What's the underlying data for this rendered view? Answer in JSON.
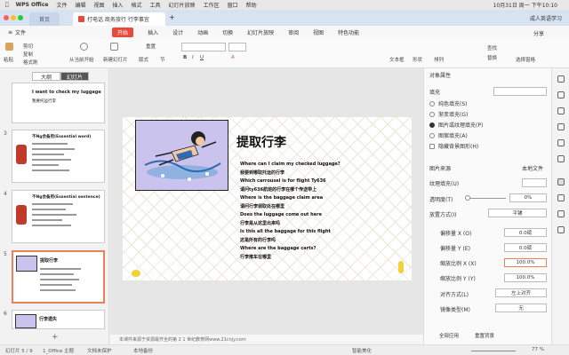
{
  "mac_menu": [
    "WPS Office",
    "文件",
    "编辑",
    "视图",
    "插入",
    "格式",
    "工具",
    "幻灯片放映",
    "工作区",
    "窗口",
    "帮助"
  ],
  "clock": "10月31日 周一 下午10:10",
  "user": "成人英语学习",
  "tabs": {
    "home": "首页",
    "doc": "打电话 商务旅行 行李事宜"
  },
  "menubar": {
    "file": "文件",
    "start": "开始",
    "items": [
      "插入",
      "设计",
      "动画",
      "切换",
      "幻灯片放映",
      "审阅",
      "视图",
      "特色功能"
    ],
    "share": "分享"
  },
  "ribbon": {
    "paste": "粘贴",
    "cut": "剪切",
    "copy": "复制",
    "format_painter": "格式刷",
    "from_current": "从当前开始",
    "new_slide": "新建幻灯片",
    "layout": "版式",
    "section": "节",
    "reset": "重置",
    "textbox": "文本框",
    "shape": "形状",
    "arrange": "排列",
    "find": "查找",
    "replace": "替换",
    "select_pane": "选择窗格"
  },
  "left_tabs": {
    "outline": "大纲",
    "slides": "幻灯片"
  },
  "thumbs": [
    {
      "num": "",
      "title": "I want to check my luggage",
      "sub": "我要托运行李"
    },
    {
      "num": "3",
      "title": "不Ng会备用(Essential word)"
    },
    {
      "num": "4",
      "title": "不Ng会备用(Essential sentence)"
    },
    {
      "num": "5",
      "title": "提取行李"
    },
    {
      "num": "6",
      "title": "行李遗失"
    }
  ],
  "slide": {
    "title": "提取行李",
    "lines": [
      "Where can I claim my checked luggage?",
      "我要到哪取托运的行李",
      "Which carrousel is for flight Ty636",
      "请问ty636航班的行李在哪个传送带上",
      "Where is the baggage claim area",
      "请问行李领取处在哪里",
      "Does the luggage come out here",
      "行李是从这里出来吗",
      "Is this all the baggage for this flight",
      "这是所有的行李吗",
      "Where are the baggage carts?",
      "行李推车在哪里"
    ]
  },
  "note_text": "本课件来源于资源最齐全的第 2 1 世纪教育网www.21cnjy.com",
  "right_panel": {
    "header": "对象属性",
    "fill": "填充",
    "options": [
      "纯色填充(S)",
      "渐变填充(G)",
      "图片或纹理填充(P)",
      "图案填充(A)",
      "隐藏背景图形(H)"
    ],
    "selected_option": 2,
    "pic_source": "图片来源",
    "local_file": "本地文件",
    "texture_fill": "纹理填充(U)",
    "transparency": "透明度(T)",
    "transparency_value": "0%",
    "placement": "放置方式(I)",
    "placement_value": "平铺",
    "offset_x": "偏移量 X (O)",
    "offset_x_value": "0.0磅",
    "offset_y": "偏移量 Y (E)",
    "offset_y_value": "0.0磅",
    "scale_x": "缩放比例 X (X)",
    "scale_x_value": "100.0%",
    "scale_y": "缩放比例 Y (Y)",
    "scale_y_value": "100.0%",
    "align": "对齐方式(L)",
    "align_value": "左上对齐",
    "mirror": "镜像类型(M)",
    "mirror_value": "无",
    "apply_all": "全部应用",
    "reset_bg": "重置背景"
  },
  "status": {
    "slide": "幻灯片 5 / 9",
    "theme": "1_Office 主题",
    "doc_protect": "文档未保护",
    "backup": "本地备份",
    "smart": "智能美化",
    "zoom": "77 %"
  },
  "colors": {
    "accent": "#e54b3c",
    "selection": "#e8825a",
    "slide_pic_bg": "#c9c3ee"
  }
}
